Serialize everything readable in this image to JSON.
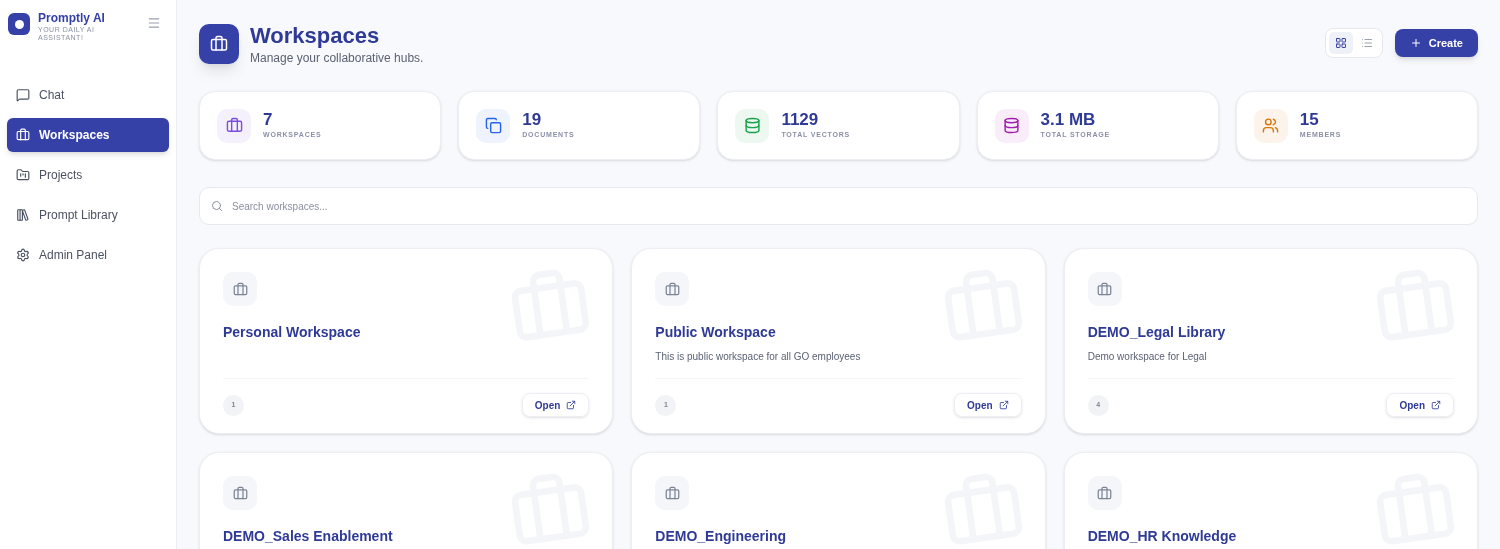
{
  "brand": {
    "name": "Promptly AI",
    "tagline": "YOUR DAILY AI ASSISTANT!"
  },
  "nav": [
    {
      "label": "Chat",
      "selected": false
    },
    {
      "label": "Workspaces",
      "selected": true
    },
    {
      "label": "Projects",
      "selected": false
    },
    {
      "label": "Prompt Library",
      "selected": false
    },
    {
      "label": "Admin Panel",
      "selected": false
    }
  ],
  "header": {
    "title": "Workspaces",
    "subtitle": "Manage your collaborative hubs."
  },
  "view_toggle": [
    {
      "kind": "grid",
      "selected": true
    },
    {
      "kind": "list",
      "selected": false
    }
  ],
  "create_button": "Create",
  "stats": [
    {
      "value": "7",
      "label": "WORKSPACES",
      "color": "#7c4dde"
    },
    {
      "value": "19",
      "label": "DOCUMENTS",
      "color": "#2563eb"
    },
    {
      "value": "1129",
      "label": "TOTAL VECTORS",
      "color": "#16a34a"
    },
    {
      "value": "3.1 MB",
      "label": "TOTAL STORAGE",
      "color": "#a21caf"
    },
    {
      "value": "15",
      "label": "MEMBERS",
      "color": "#d97706"
    }
  ],
  "search": {
    "placeholder": "Search workspaces..."
  },
  "workspaces": [
    {
      "name": "Personal Workspace",
      "count": "1",
      "action": "Open"
    },
    {
      "name": "Public Workspace",
      "description": "This is public workspace for all GO employees",
      "count": "1",
      "action": "Open"
    },
    {
      "name": "DEMO_Legal Library",
      "description": "Demo workspace for Legal",
      "count": "4",
      "action": "Open"
    },
    {
      "name": "DEMO_Sales Enablement"
    },
    {
      "name": "DEMO_Engineering"
    },
    {
      "name": "DEMO_HR Knowledge"
    }
  ]
}
